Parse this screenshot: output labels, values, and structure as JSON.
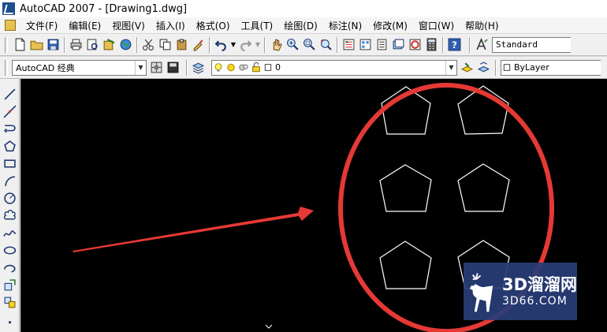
{
  "window": {
    "title": "AutoCAD 2007 - [Drawing1.dwg]"
  },
  "menubar": {
    "items": [
      "文件(F)",
      "编辑(E)",
      "视图(V)",
      "插入(I)",
      "格式(O)",
      "工具(T)",
      "绘图(D)",
      "标注(N)",
      "修改(M)",
      "窗口(W)",
      "帮助(H)"
    ]
  },
  "toolbar_standard": {
    "text_style_value": "Standard"
  },
  "toolbar_properties": {
    "workspace_value": "AutoCAD 经典",
    "layer_value": "0",
    "color_value": "ByLayer"
  },
  "canvas": {
    "pentagon_count": 6,
    "annotation_color": "#e53935",
    "line_color": "#ffffff"
  },
  "watermark": {
    "brand": "3D溜溜网",
    "domain": "3D66.COM"
  }
}
